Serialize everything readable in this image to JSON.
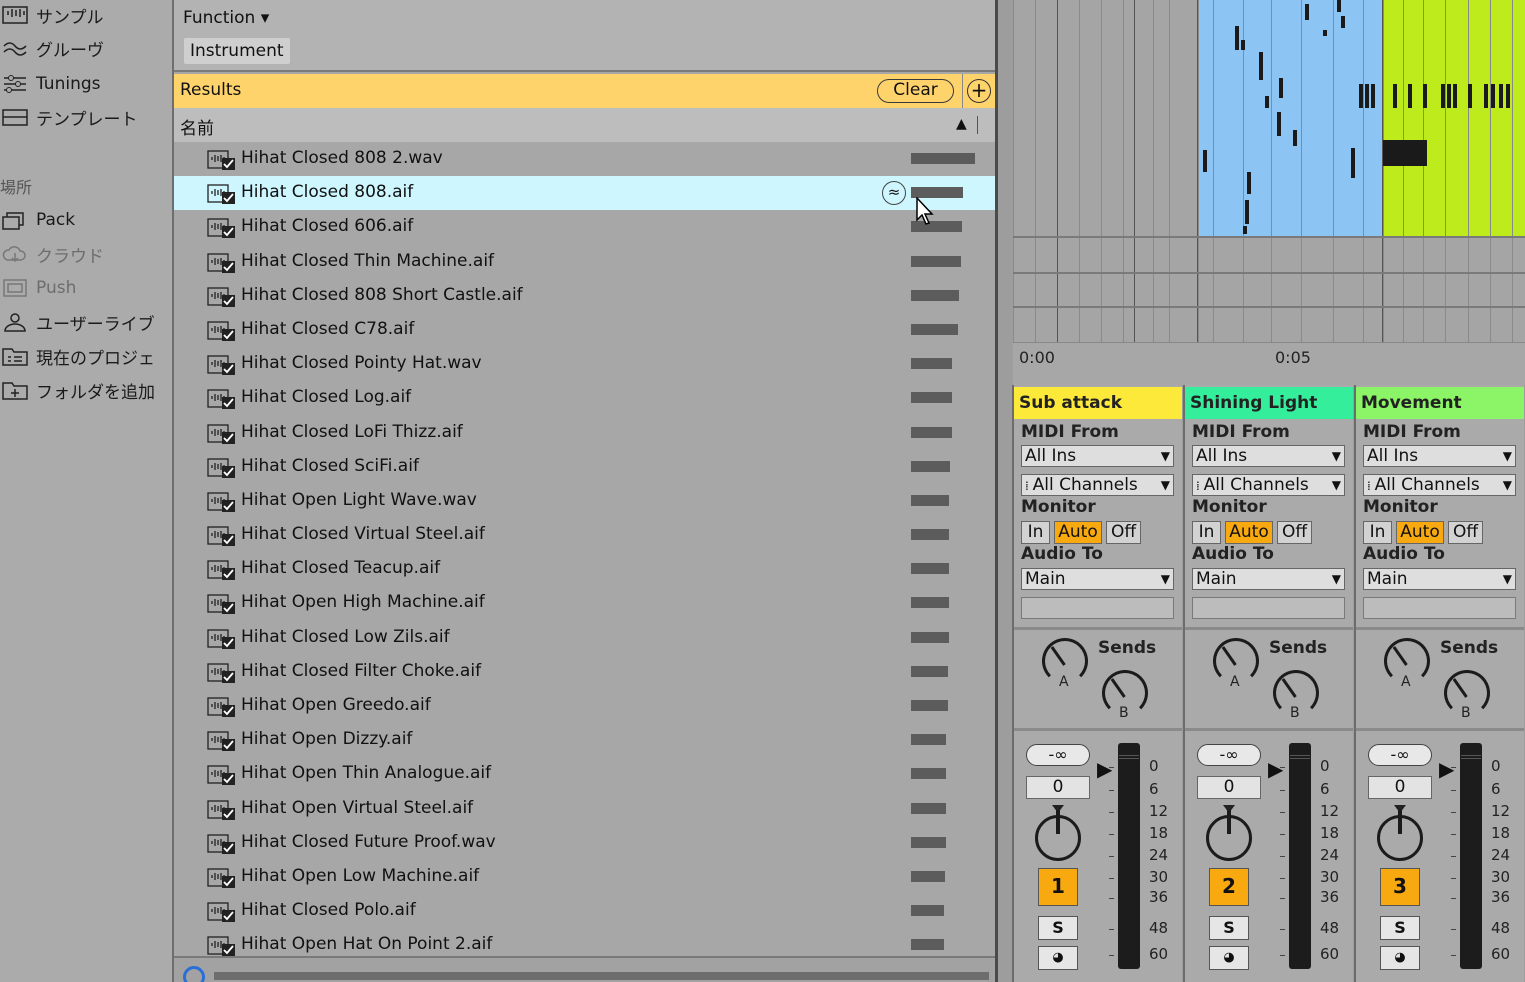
{
  "sidebar": {
    "items": [
      {
        "label": "サンプル",
        "icon": "sample-icon",
        "dim": false
      },
      {
        "label": "グルーヴ",
        "icon": "groove-icon",
        "dim": false
      },
      {
        "label": "Tunings",
        "icon": "tunings-icon",
        "dim": false
      },
      {
        "label": "テンプレート",
        "icon": "template-icon",
        "dim": false
      }
    ],
    "places_heading": "場所",
    "places": [
      {
        "label": "Pack",
        "icon": "pack-icon",
        "dim": false
      },
      {
        "label": "クラウド",
        "icon": "cloud-icon",
        "dim": true
      },
      {
        "label": "Push",
        "icon": "push-icon",
        "dim": true
      },
      {
        "label": "ユーザーライブ",
        "icon": "user-library-icon",
        "dim": false
      },
      {
        "label": "現在のプロジェ",
        "icon": "current-project-icon",
        "dim": false
      },
      {
        "label": "フォルダを追加",
        "icon": "add-folder-icon",
        "dim": false
      }
    ]
  },
  "browser": {
    "filter_label": "Function ▾",
    "filter_chip": "Instrument",
    "results_label": "Results",
    "clear_label": "Clear",
    "add_label": "+",
    "column_name": "名前",
    "sort_icon": "▲",
    "rows": [
      {
        "name": "Hihat Closed 808 2.wav",
        "duration": 0.86
      },
      {
        "name": "Hihat Closed 808.aif",
        "duration": 0.7,
        "selected": true
      },
      {
        "name": "Hihat Closed 606.aif",
        "duration": 0.69
      },
      {
        "name": "Hihat Closed Thin Machine.aif",
        "duration": 0.68
      },
      {
        "name": "Hihat Closed 808 Short Castle.aif",
        "duration": 0.65
      },
      {
        "name": "Hihat Closed C78.aif",
        "duration": 0.63
      },
      {
        "name": "Hihat Closed Pointy Hat.wav",
        "duration": 0.56
      },
      {
        "name": "Hihat Closed Log.aif",
        "duration": 0.55
      },
      {
        "name": "Hihat Closed LoFi Thizz.aif",
        "duration": 0.55
      },
      {
        "name": "Hihat Closed SciFi.aif",
        "duration": 0.53
      },
      {
        "name": "Hihat Open Light Wave.wav",
        "duration": 0.52
      },
      {
        "name": "Hihat Closed Virtual Steel.aif",
        "duration": 0.52
      },
      {
        "name": "Hihat Closed Teacup.aif",
        "duration": 0.52
      },
      {
        "name": "Hihat Open High Machine.aif",
        "duration": 0.52
      },
      {
        "name": "Hihat Closed Low Zils.aif",
        "duration": 0.51
      },
      {
        "name": "Hihat Closed Filter Choke.aif",
        "duration": 0.5
      },
      {
        "name": "Hihat Open Greedo.aif",
        "duration": 0.5
      },
      {
        "name": "Hihat Open Dizzy.aif",
        "duration": 0.47
      },
      {
        "name": "Hihat Open Thin Analogue.aif",
        "duration": 0.47
      },
      {
        "name": "Hihat Open Virtual Steel.aif",
        "duration": 0.47
      },
      {
        "name": "Hihat Closed Future Proof.wav",
        "duration": 0.47
      },
      {
        "name": "Hihat Open Low Machine.aif",
        "duration": 0.46
      },
      {
        "name": "Hihat Closed Polo.aif",
        "duration": 0.45
      },
      {
        "name": "Hihat Open Hat On Point 2.aif",
        "duration": 0.45
      }
    ]
  },
  "timeline": {
    "markers": [
      "0:00",
      "0:05"
    ]
  },
  "tracks": [
    {
      "title": "Sub attack",
      "color": "#fde93a",
      "midi_from_label": "MIDI From",
      "midi_from": "All Ins",
      "channels": "All Channels",
      "monitor_label": "Monitor",
      "monitor": [
        "In",
        "Auto",
        "Off"
      ],
      "monitor_active": "Auto",
      "audio_to_label": "Audio To",
      "audio_to": "Main",
      "sends_label": "Sends",
      "send_a": "A",
      "send_b": "B",
      "volume": "-∞",
      "pan": "0",
      "number": "1",
      "solo": "S",
      "arm": "◕",
      "scale": [
        "0",
        "6",
        "12",
        "18",
        "24",
        "30",
        "36",
        "48",
        "60"
      ]
    },
    {
      "title": "Shining Light",
      "color": "#35ee9c",
      "midi_from_label": "MIDI From",
      "midi_from": "All Ins",
      "channels": "All Channels",
      "monitor_label": "Monitor",
      "monitor": [
        "In",
        "Auto",
        "Off"
      ],
      "monitor_active": "Auto",
      "audio_to_label": "Audio To",
      "audio_to": "Main",
      "sends_label": "Sends",
      "send_a": "A",
      "send_b": "B",
      "volume": "-∞",
      "pan": "0",
      "number": "2",
      "solo": "S",
      "arm": "◕",
      "scale": [
        "0",
        "6",
        "12",
        "18",
        "24",
        "30",
        "36",
        "48",
        "60"
      ]
    },
    {
      "title": "Movement",
      "color": "#8cf567",
      "midi_from_label": "MIDI From",
      "midi_from": "All Ins",
      "channels": "All Channels",
      "monitor_label": "Monitor",
      "monitor": [
        "In",
        "Auto",
        "Off"
      ],
      "monitor_active": "Auto",
      "audio_to_label": "Audio To",
      "audio_to": "Main",
      "sends_label": "Sends",
      "send_a": "A",
      "send_b": "B",
      "volume": "-∞",
      "pan": "0",
      "number": "3",
      "solo": "S",
      "arm": "◕",
      "scale": [
        "0",
        "6",
        "12",
        "18",
        "24",
        "30",
        "36",
        "48",
        "60"
      ]
    }
  ],
  "colors": {
    "results_bar": "#ffd36b",
    "selected_row": "#cdf6ff",
    "accent_orange": "#f7a90f",
    "clip_blue": "#8cc4f4",
    "clip_green": "#bdeb1c"
  }
}
